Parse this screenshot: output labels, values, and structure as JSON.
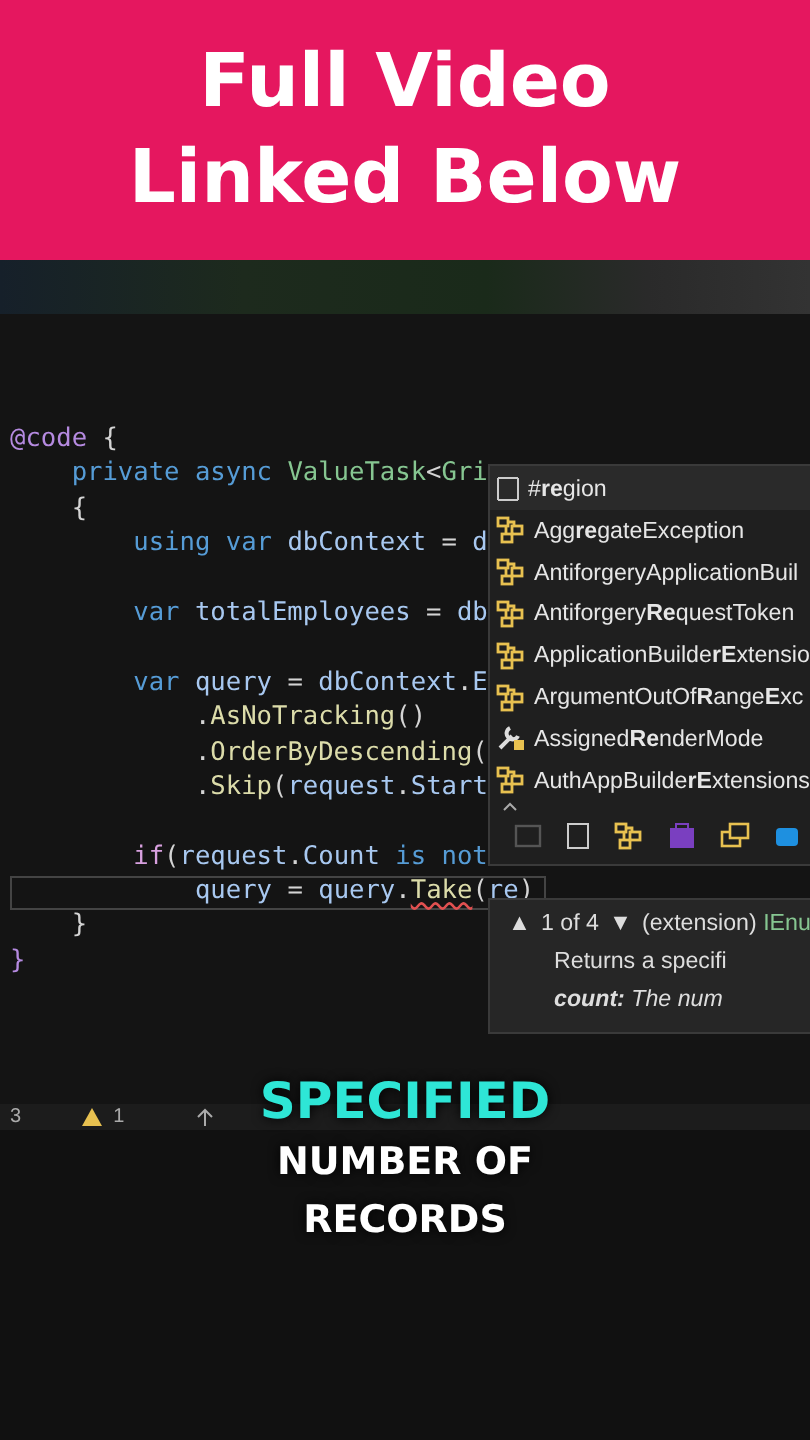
{
  "banner": {
    "lines": [
      "Full Video",
      "Linked Below"
    ]
  },
  "editor": {
    "lines": [
      {
        "kind": "code",
        "current": false,
        "tokens": [
          {
            "kind": "directive",
            "text": "@code"
          },
          {
            "kind": "plain",
            "text": " {"
          }
        ]
      },
      {
        "kind": "code",
        "current": false,
        "tokens": [
          {
            "kind": "keyword",
            "text": "    private async "
          },
          {
            "kind": "type",
            "text": "ValueTask"
          },
          {
            "kind": "plain",
            "text": "<"
          },
          {
            "kind": "type",
            "text": "Gri"
          }
        ]
      },
      {
        "kind": "code",
        "current": false,
        "tokens": [
          {
            "kind": "plain",
            "text": "    {"
          }
        ]
      },
      {
        "kind": "code",
        "current": false,
        "tokens": [
          {
            "kind": "keyword",
            "text": "        using var "
          },
          {
            "kind": "variable",
            "text": "dbContext"
          },
          {
            "kind": "plain",
            "text": " = "
          },
          {
            "kind": "variable",
            "text": "d"
          }
        ]
      },
      {
        "kind": "blank",
        "current": false
      },
      {
        "kind": "code",
        "current": false,
        "tokens": [
          {
            "kind": "keyword",
            "text": "        var "
          },
          {
            "kind": "variable",
            "text": "totalEmployees"
          },
          {
            "kind": "plain",
            "text": " = "
          },
          {
            "kind": "variable",
            "text": "db"
          }
        ]
      },
      {
        "kind": "blank",
        "current": false
      },
      {
        "kind": "code",
        "current": false,
        "tokens": [
          {
            "kind": "keyword",
            "text": "        var "
          },
          {
            "kind": "variable",
            "text": "query"
          },
          {
            "kind": "plain",
            "text": " = "
          },
          {
            "kind": "variable",
            "text": "dbContext"
          },
          {
            "kind": "plain",
            "text": "."
          },
          {
            "kind": "variable",
            "text": "E"
          }
        ]
      },
      {
        "kind": "code",
        "current": false,
        "tokens": [
          {
            "kind": "plain",
            "text": "            ."
          },
          {
            "kind": "method",
            "text": "AsNoTracking"
          },
          {
            "kind": "plain",
            "text": "()"
          }
        ]
      },
      {
        "kind": "code",
        "current": false,
        "tokens": [
          {
            "kind": "plain",
            "text": "            ."
          },
          {
            "kind": "method",
            "text": "OrderByDescending"
          },
          {
            "kind": "plain",
            "text": "("
          }
        ]
      },
      {
        "kind": "code",
        "current": false,
        "tokens": [
          {
            "kind": "plain",
            "text": "            ."
          },
          {
            "kind": "method",
            "text": "Skip"
          },
          {
            "kind": "plain",
            "text": "("
          },
          {
            "kind": "variable",
            "text": "request"
          },
          {
            "kind": "plain",
            "text": "."
          },
          {
            "kind": "variable",
            "text": "Start"
          }
        ]
      },
      {
        "kind": "blank",
        "current": false
      },
      {
        "kind": "code",
        "current": false,
        "tokens": [
          {
            "kind": "control",
            "text": "        if"
          },
          {
            "kind": "plain",
            "text": "("
          },
          {
            "kind": "variable",
            "text": "request"
          },
          {
            "kind": "plain",
            "text": "."
          },
          {
            "kind": "variable",
            "text": "Count"
          },
          {
            "kind": "keyword",
            "text": " is not"
          }
        ]
      },
      {
        "kind": "code",
        "current": true,
        "tokens": [
          {
            "kind": "variable",
            "text": "            query"
          },
          {
            "kind": "plain",
            "text": " = "
          },
          {
            "kind": "variable",
            "text": "query"
          },
          {
            "kind": "plain",
            "text": "."
          },
          {
            "kind": "error-method",
            "text": "Take"
          },
          {
            "kind": "plain",
            "text": "("
          },
          {
            "kind": "variable",
            "text": "re"
          },
          {
            "kind": "plain",
            "text": ")"
          }
        ]
      },
      {
        "kind": "code",
        "current": false,
        "tokens": [
          {
            "kind": "plain",
            "text": "    }"
          }
        ]
      },
      {
        "kind": "code",
        "current": false,
        "tokens": [
          {
            "kind": "directive",
            "text": "}"
          }
        ]
      }
    ]
  },
  "completion": {
    "filter": "#**re**gion",
    "items": [
      {
        "kind": "class",
        "text": "Agg**re**gateException"
      },
      {
        "kind": "class",
        "text": "AntiforgeryApplicationBuil"
      },
      {
        "kind": "class",
        "text": "Antiforgery**Re**questToken"
      },
      {
        "kind": "class",
        "text": "ApplicationBuilde**rE**xtensio"
      },
      {
        "kind": "class",
        "text": "ArgumentOutOf**R**ange**E**xc"
      },
      {
        "kind": "property",
        "text": "Assigned**Re**nderMode"
      },
      {
        "kind": "class",
        "text": "AuthAppBuilde**rE**xtensions"
      }
    ]
  },
  "tooltip": {
    "prev": "▲",
    "counter": "1 of 4",
    "next": "▼",
    "signature_prefix": "(extension) ",
    "signature_type": "IEnu",
    "summary": "Returns a specifi",
    "param_name": "count:",
    "param_text": " The num"
  },
  "status_bar": {
    "counts": [
      "3",
      "1"
    ]
  },
  "caption": {
    "highlight": "SPECIFIED",
    "lines": [
      "NUMBER OF",
      "RECORDS"
    ]
  }
}
